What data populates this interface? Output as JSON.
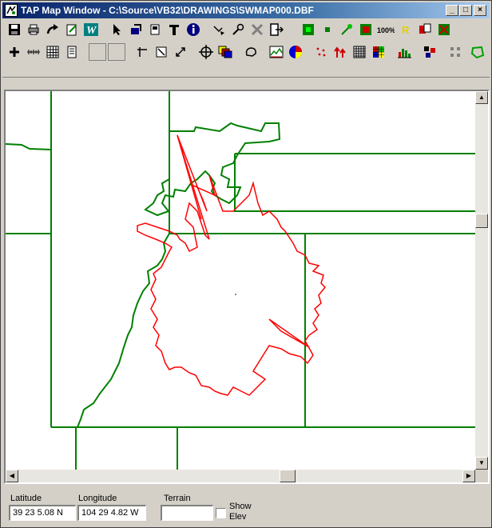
{
  "window": {
    "title": "TAP Map Window - C:\\Source\\VB32\\DRAWINGS\\SWMAP000.DBF",
    "buttons": {
      "minimize": "_",
      "maximize": "□",
      "close": "×"
    }
  },
  "toolbar1": [
    {
      "name": "save-icon"
    },
    {
      "name": "print-icon"
    },
    {
      "name": "redo-arrow-icon"
    },
    {
      "name": "edit-doc-icon"
    },
    {
      "name": "w-text-icon",
      "label": "W"
    },
    {
      "name": "pointer-icon"
    },
    {
      "name": "open-layer-icon"
    },
    {
      "name": "device-icon"
    },
    {
      "name": "text-tool-icon",
      "label": "T"
    },
    {
      "name": "info-icon",
      "label": "i"
    },
    {
      "name": "path-arrow-icon"
    },
    {
      "name": "key-icon"
    },
    {
      "name": "delete-x-icon"
    },
    {
      "name": "exit-door-icon"
    },
    {
      "name": "grid-green-icon"
    },
    {
      "name": "dot-icon"
    },
    {
      "name": "wand-icon"
    },
    {
      "name": "red-green-icon"
    },
    {
      "name": "zoom-100-icon",
      "label": "100%"
    },
    {
      "name": "r-icon",
      "label": "R"
    },
    {
      "name": "export-red-icon"
    },
    {
      "name": "import-green-icon"
    }
  ],
  "toolbar2": [
    {
      "name": "add-icon"
    },
    {
      "name": "ruler-icon"
    },
    {
      "name": "grid-icon"
    },
    {
      "name": "page-icon"
    },
    {
      "name": "corner-tool-icon"
    },
    {
      "name": "resize-box-icon"
    },
    {
      "name": "diagonal-icon"
    },
    {
      "name": "crosshair-icon"
    },
    {
      "name": "color-layers-icon"
    },
    {
      "name": "lasso-icon"
    },
    {
      "name": "terrain-icon"
    },
    {
      "name": "pie-icon"
    },
    {
      "name": "scatter-icon"
    },
    {
      "name": "arrows-up-icon"
    },
    {
      "name": "grid-black-icon"
    },
    {
      "name": "color-grid-icon"
    },
    {
      "name": "histogram-icon"
    },
    {
      "name": "tiles-icon"
    },
    {
      "name": "dots-grid-icon"
    },
    {
      "name": "polygon-icon"
    }
  ],
  "map": {
    "boundary_color": "#008000",
    "coverage_color": "#ff0000"
  },
  "status": {
    "latitude_label": "Latitude",
    "latitude_value": "39 23 5.08 N",
    "longitude_label": "Longitude",
    "longitude_value": "104 29 4.82 W",
    "terrain_label": "Terrain",
    "terrain_value": "",
    "show_elev_label_1": "Show",
    "show_elev_label_2": "Elev"
  }
}
